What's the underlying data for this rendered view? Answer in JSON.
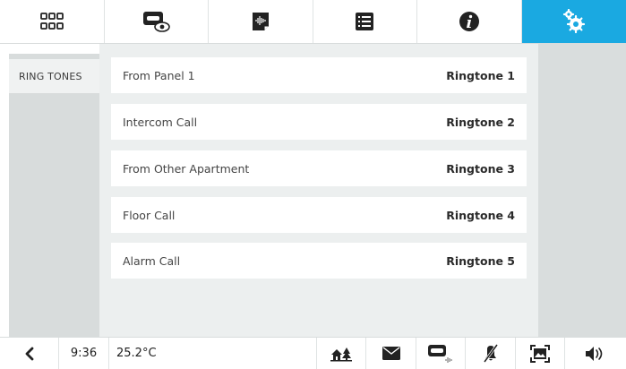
{
  "topbar": {
    "tabs": [
      {
        "icon": "grid-icon",
        "active": false
      },
      {
        "icon": "camera-view-icon",
        "active": false
      },
      {
        "icon": "voice-memo-icon",
        "active": false
      },
      {
        "icon": "list-icon",
        "active": false
      },
      {
        "icon": "info-icon",
        "active": false
      },
      {
        "icon": "settings-gears-icon",
        "active": true
      }
    ],
    "active_color": "#1aa9e1"
  },
  "sidebar": {
    "items": [
      {
        "label": "RING TONES",
        "selected": true
      }
    ]
  },
  "ringtones": [
    {
      "label": "From Panel 1",
      "value": "Ringtone 1"
    },
    {
      "label": "Intercom Call",
      "value": "Ringtone 2"
    },
    {
      "label": "From Other Apartment",
      "value": "Ringtone 3"
    },
    {
      "label": "Floor Call",
      "value": "Ringtone 4"
    },
    {
      "label": "Alarm Call",
      "value": "Ringtone 5"
    }
  ],
  "statusbar": {
    "back_icon": "chevron-left-icon",
    "time": "9:36",
    "temperature": "25.2°C",
    "icons": [
      "home-garden-icon",
      "envelope-icon",
      "answering-machine-icon",
      "mute-icon",
      "screen-capture-icon",
      "speaker-icon"
    ]
  }
}
